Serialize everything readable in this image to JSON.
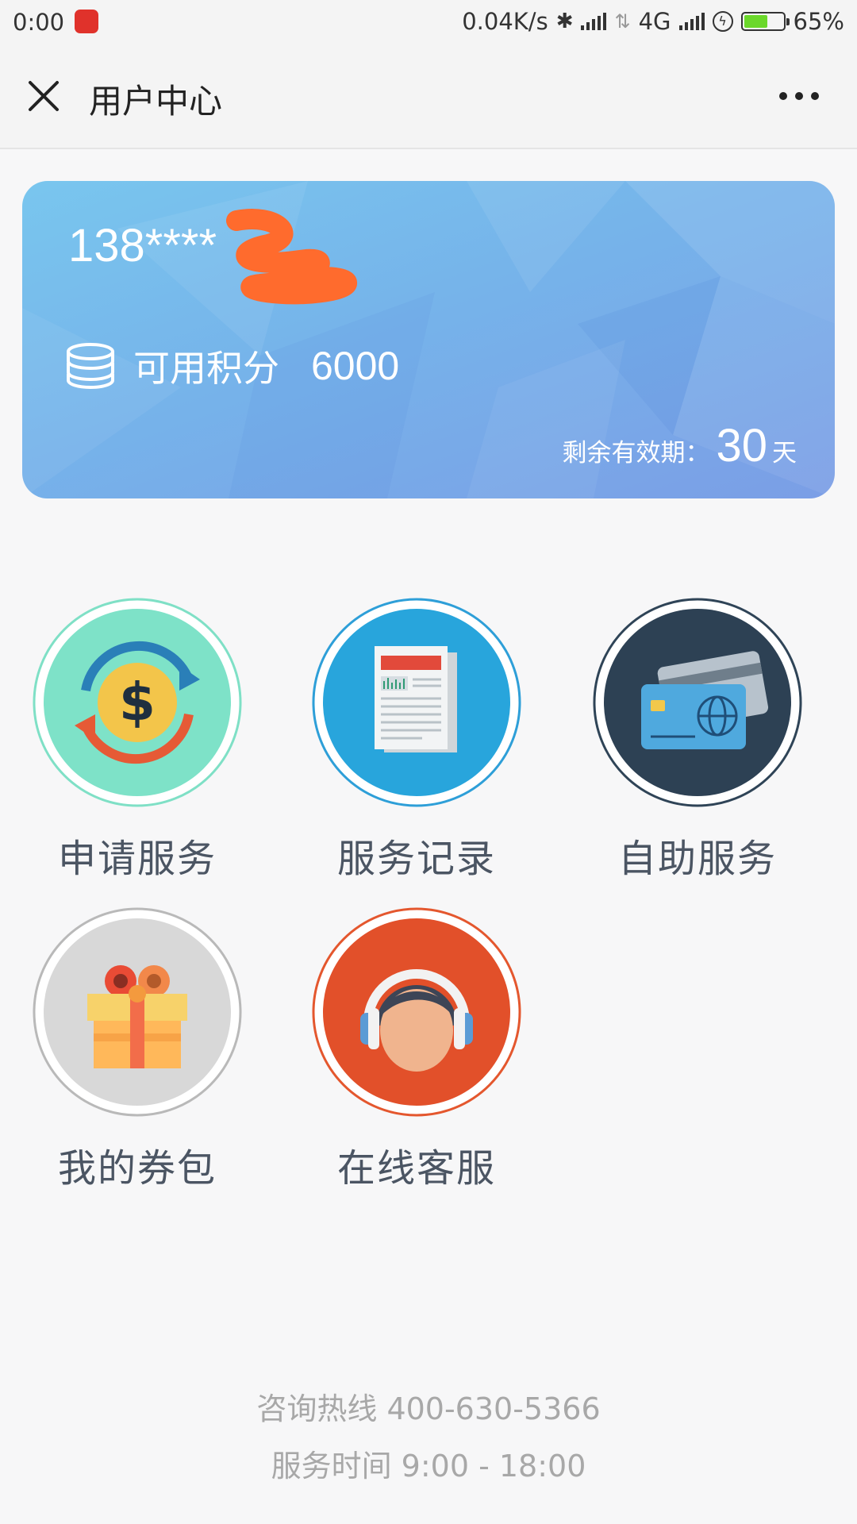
{
  "status_bar": {
    "time": "0:00",
    "network_speed": "0.04K/s",
    "network_type": "4G",
    "battery_percent": "65%",
    "battery_level": 0.65
  },
  "header": {
    "title": "用户中心",
    "close_icon": "close-icon",
    "more_icon": "more-icon"
  },
  "card": {
    "phone_masked": "138****",
    "points_label": "可用积分",
    "points_value": "6000",
    "validity_label": "剩余有效期：",
    "validity_value": "30",
    "validity_unit": "天",
    "colors": {
      "gradient_start": "#79c6ee",
      "gradient_end": "#7b9ee6"
    }
  },
  "services": [
    {
      "label": "申请服务",
      "icon": "dollar-exchange-icon",
      "ring_color": "#7fe0c6",
      "fill": "#7ee2c8"
    },
    {
      "label": "服务记录",
      "icon": "newspaper-icon",
      "ring_color": "#2e9fd8",
      "fill": "#28a5dc"
    },
    {
      "label": "自助服务",
      "icon": "credit-card-icon",
      "ring_color": "#2f4457",
      "fill": "#2d4154"
    },
    {
      "label": "我的券包",
      "icon": "gift-icon",
      "ring_color": "#b9b9b9",
      "fill": "#d8d8d8"
    },
    {
      "label": "在线客服",
      "icon": "headset-agent-icon",
      "ring_color": "#e4572e",
      "fill": "#e2502a"
    }
  ],
  "footer": {
    "hotline": "咨询热线 400-630-5366",
    "hours": "服务时间 9:00 - 18:00"
  }
}
